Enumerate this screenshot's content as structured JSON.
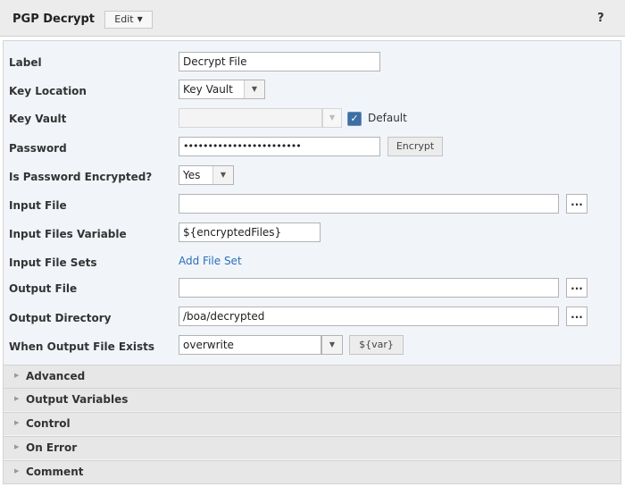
{
  "header": {
    "title": "PGP Decrypt",
    "edit_label": "Edit",
    "help_label": "?"
  },
  "form": {
    "label": {
      "label": "Label",
      "value": "Decrypt File"
    },
    "key_location": {
      "label": "Key Location",
      "value": "Key Vault"
    },
    "key_vault": {
      "label": "Key Vault",
      "value": "",
      "default_label": "Default",
      "default_checked": true
    },
    "password": {
      "label": "Password",
      "value": "••••••••••••••••••••••••",
      "encrypt_label": "Encrypt"
    },
    "is_password_encrypted": {
      "label": "Is Password Encrypted?",
      "value": "Yes"
    },
    "input_file": {
      "label": "Input File",
      "value": "",
      "browse_label": "..."
    },
    "input_files_variable": {
      "label": "Input Files Variable",
      "value": "${encryptedFiles}"
    },
    "input_file_sets": {
      "label": "Input File Sets",
      "link": "Add File Set"
    },
    "output_file": {
      "label": "Output File",
      "value": "",
      "browse_label": "..."
    },
    "output_directory": {
      "label": "Output Directory",
      "value": "/boa/decrypted",
      "browse_label": "..."
    },
    "when_output_file_exists": {
      "label": "When Output File Exists",
      "value": "overwrite",
      "var_label": "${var}"
    }
  },
  "sections": [
    {
      "title": "Advanced"
    },
    {
      "title": "Output Variables"
    },
    {
      "title": "Control"
    },
    {
      "title": "On Error"
    },
    {
      "title": "Comment"
    }
  ],
  "icons": {
    "dropdown": "chevron-down-icon",
    "section_toggle": "triangle-right-icon",
    "checkbox": "checkmark-icon"
  }
}
